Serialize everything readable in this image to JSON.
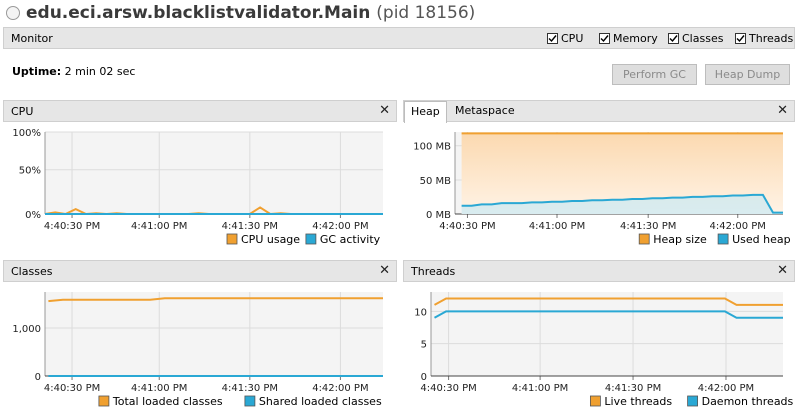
{
  "window": {
    "title": "edu.eci.arsw.blacklistvalidator.Main",
    "pid": "(pid 18156)"
  },
  "monitor": {
    "label": "Monitor",
    "checkboxes": [
      {
        "label": "CPU",
        "checked": true
      },
      {
        "label": "Memory",
        "checked": true
      },
      {
        "label": "Classes",
        "checked": true
      },
      {
        "label": "Threads",
        "checked": true
      }
    ]
  },
  "uptime": {
    "label": "Uptime:",
    "value": "2 min 02 sec"
  },
  "buttons": {
    "perform_gc": "Perform GC",
    "heap_dump": "Heap Dump"
  },
  "colors": {
    "orange": "#f0a030",
    "blue": "#2aa8d4",
    "heap_fill": "#fbd9b0"
  },
  "icons": {
    "app": "app-icon",
    "close": "close-icon",
    "checkbox": "checkbox-checked-icon"
  },
  "panels": {
    "cpu": {
      "title": "CPU",
      "close": "✕",
      "chart_data": {
        "type": "line",
        "ylim": [
          0,
          100
        ],
        "yticks": [
          "100%",
          "50%",
          "0%"
        ],
        "xticks": [
          "4:40:30 PM",
          "4:41:00 PM",
          "4:41:30 PM",
          "4:42:00 PM"
        ],
        "series": [
          {
            "name": "CPU usage",
            "values": [
              0,
              2,
              0,
              6,
              0,
              1,
              0,
              1,
              0,
              0,
              0,
              0,
              0,
              0,
              0,
              1,
              0,
              0,
              0,
              0,
              0,
              8,
              0,
              1,
              0,
              0,
              0,
              0,
              0,
              0,
              0,
              0,
              0,
              0
            ]
          },
          {
            "name": "GC activity",
            "values": [
              0,
              0,
              0,
              0,
              0,
              0,
              0,
              0,
              0,
              0,
              0,
              0,
              0,
              0,
              0,
              0,
              0,
              0,
              0,
              0,
              0,
              0,
              0,
              0,
              0,
              0,
              0,
              0,
              0,
              0,
              0,
              0,
              0,
              0
            ]
          }
        ]
      }
    },
    "heap": {
      "tabs": [
        "Heap",
        "Metaspace"
      ],
      "close": "✕",
      "chart_data": {
        "type": "area",
        "ylim": [
          0,
          120
        ],
        "yticks": [
          "100 MB",
          "50 MB",
          "0 MB"
        ],
        "xticks": [
          "4:40:30 PM",
          "4:41:00 PM",
          "4:41:30 PM",
          "4:42:00 PM"
        ],
        "series": [
          {
            "name": "Heap size",
            "values": [
              118,
              118,
              118,
              118,
              118,
              118,
              118,
              118,
              118,
              118,
              118,
              118,
              118,
              118,
              118,
              118,
              118,
              118,
              118,
              118,
              118,
              118,
              118,
              118,
              118,
              118,
              118,
              118,
              118,
              118,
              118,
              118,
              118
            ]
          },
          {
            "name": "Used heap",
            "values": [
              12,
              12,
              14,
              14,
              16,
              16,
              16,
              17,
              17,
              18,
              18,
              19,
              19,
              20,
              20,
              21,
              21,
              22,
              22,
              23,
              23,
              24,
              24,
              25,
              25,
              26,
              26,
              27,
              27,
              28,
              28,
              2,
              2
            ]
          }
        ]
      }
    },
    "classes": {
      "title": "Classes",
      "close": "✕",
      "chart_data": {
        "type": "line",
        "ylim": [
          0,
          1750
        ],
        "yticks": [
          "1,000",
          "0"
        ],
        "xticks": [
          "4:40:30 PM",
          "4:41:00 PM",
          "4:41:30 PM",
          "4:42:00 PM"
        ],
        "series": [
          {
            "name": "Total loaded classes",
            "values": [
              1560,
              1590,
              1590,
              1590,
              1590,
              1590,
              1590,
              1590,
              1620,
              1620,
              1620,
              1620,
              1620,
              1620,
              1620,
              1620,
              1620,
              1620,
              1620,
              1620,
              1620,
              1620,
              1620,
              1620
            ]
          },
          {
            "name": "Shared loaded classes",
            "values": [
              0,
              0,
              0,
              0,
              0,
              0,
              0,
              0,
              0,
              0,
              0,
              0,
              0,
              0,
              0,
              0,
              0,
              0,
              0,
              0,
              0,
              0,
              0,
              0
            ]
          }
        ]
      }
    },
    "threads": {
      "title": "Threads",
      "close": "✕",
      "chart_data": {
        "type": "line",
        "ylim": [
          0,
          13
        ],
        "yticks": [
          "10",
          "5",
          "0"
        ],
        "xticks": [
          "4:40:30 PM",
          "4:41:00 PM",
          "4:41:30 PM",
          "4:42:00 PM"
        ],
        "series": [
          {
            "name": "Live threads",
            "values": [
              11,
              12,
              12,
              12,
              12,
              12,
              12,
              12,
              12,
              12,
              12,
              12,
              12,
              12,
              12,
              12,
              12,
              12,
              12,
              12,
              12,
              12,
              12,
              12,
              12,
              12,
              11,
              11,
              11,
              11,
              11
            ]
          },
          {
            "name": "Daemon threads",
            "values": [
              9,
              10,
              10,
              10,
              10,
              10,
              10,
              10,
              10,
              10,
              10,
              10,
              10,
              10,
              10,
              10,
              10,
              10,
              10,
              10,
              10,
              10,
              10,
              10,
              10,
              10,
              9,
              9,
              9,
              9,
              9
            ]
          }
        ]
      }
    }
  }
}
